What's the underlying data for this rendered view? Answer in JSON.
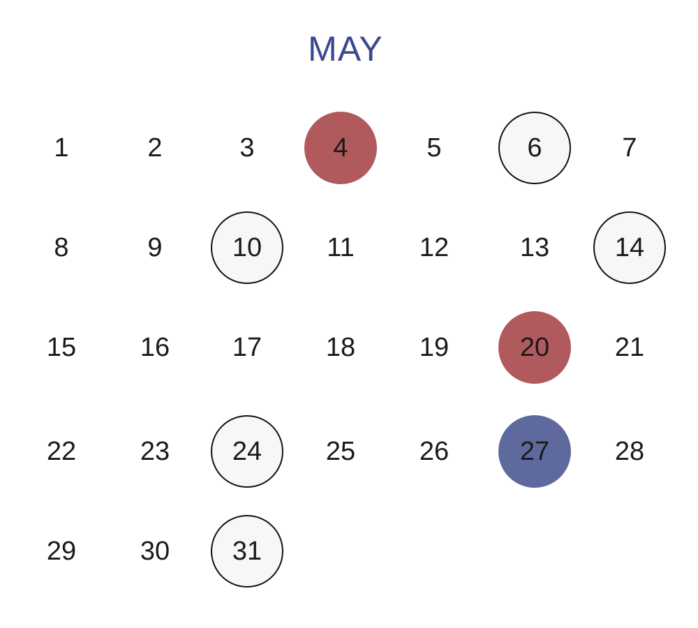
{
  "month": {
    "title": "MAY"
  },
  "colors": {
    "title": "#3a4890",
    "red_marker": "#b15a5e",
    "blue_marker": "#5e6a9e",
    "ring_border": "#111111"
  },
  "days": [
    {
      "label": "1",
      "marker": "none"
    },
    {
      "label": "2",
      "marker": "none"
    },
    {
      "label": "3",
      "marker": "none"
    },
    {
      "label": "4",
      "marker": "red"
    },
    {
      "label": "5",
      "marker": "none"
    },
    {
      "label": "6",
      "marker": "ring"
    },
    {
      "label": "7",
      "marker": "none"
    },
    {
      "label": "8",
      "marker": "none"
    },
    {
      "label": "9",
      "marker": "none"
    },
    {
      "label": "10",
      "marker": "ring"
    },
    {
      "label": "11",
      "marker": "none"
    },
    {
      "label": "12",
      "marker": "none"
    },
    {
      "label": "13",
      "marker": "none"
    },
    {
      "label": "14",
      "marker": "ring"
    },
    {
      "label": "15",
      "marker": "none"
    },
    {
      "label": "16",
      "marker": "none"
    },
    {
      "label": "17",
      "marker": "none"
    },
    {
      "label": "18",
      "marker": "none"
    },
    {
      "label": "19",
      "marker": "none"
    },
    {
      "label": "20",
      "marker": "red"
    },
    {
      "label": "21",
      "marker": "none"
    },
    {
      "label": "22",
      "marker": "none"
    },
    {
      "label": "23",
      "marker": "none"
    },
    {
      "label": "24",
      "marker": "ring"
    },
    {
      "label": "25",
      "marker": "none"
    },
    {
      "label": "26",
      "marker": "none"
    },
    {
      "label": "27",
      "marker": "blue"
    },
    {
      "label": "28",
      "marker": "none"
    },
    {
      "label": "29",
      "marker": "none"
    },
    {
      "label": "30",
      "marker": "none"
    },
    {
      "label": "31",
      "marker": "ring"
    }
  ]
}
